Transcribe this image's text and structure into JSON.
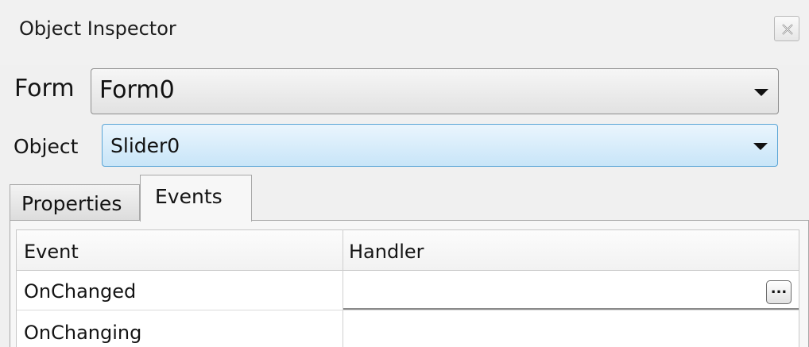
{
  "window": {
    "title": "Object Inspector",
    "close_icon": "close-x-icon"
  },
  "form_selector": {
    "label": "Form",
    "value": "Form0"
  },
  "object_selector": {
    "label": "Object",
    "value": "Slider0",
    "accent_color": "#c8e5f8"
  },
  "tabs": [
    {
      "label": "Properties",
      "selected": false
    },
    {
      "label": "Events",
      "selected": true
    }
  ],
  "events_grid": {
    "columns": [
      "Event",
      "Handler"
    ],
    "rows": [
      {
        "event": "OnChanged",
        "handler": "",
        "editing": true,
        "edit_button": "..."
      },
      {
        "event": "OnChanging",
        "handler": ""
      }
    ]
  }
}
